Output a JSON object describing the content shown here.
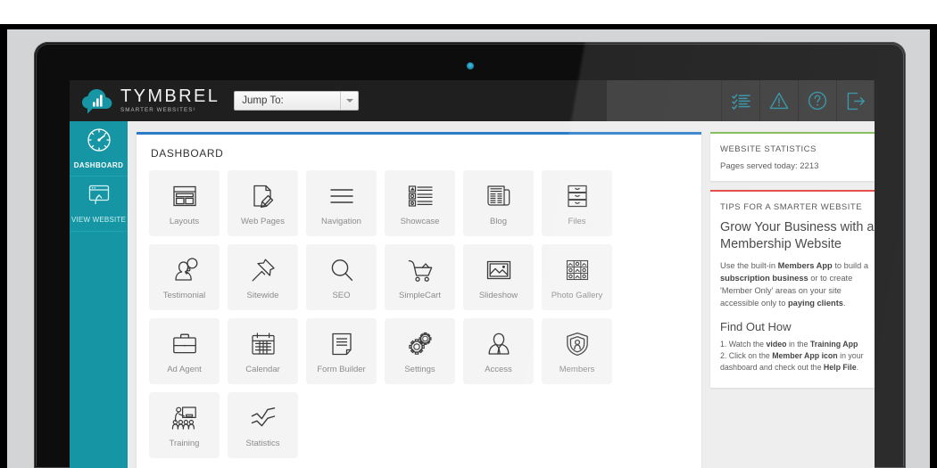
{
  "header": {
    "logo_name": "TYMBREL",
    "logo_tagline": "SMARTER WEBSITES¹",
    "logo_icon": "cloud-bar-chart-icon",
    "jump_to_label": "Jump To:",
    "icons": [
      {
        "name": "checklist-icon"
      },
      {
        "name": "warning-triangle-icon"
      },
      {
        "name": "help-question-icon"
      },
      {
        "name": "logout-icon"
      }
    ]
  },
  "sidebar": {
    "items": [
      {
        "label": "DASHBOARD",
        "icon": "speedometer-icon",
        "active": true
      },
      {
        "label": "VIEW WEBSITE",
        "icon": "browser-arrow-up-icon",
        "active": false
      }
    ]
  },
  "dashboard": {
    "title": "DASHBOARD",
    "accent_color": "#2a7cc7",
    "tiles": [
      {
        "label": "Layouts",
        "icon": "layout-grid-icon"
      },
      {
        "label": "Web Pages",
        "icon": "page-pencil-icon"
      },
      {
        "label": "Navigation",
        "icon": "menu-lines-icon"
      },
      {
        "label": "Showcase",
        "icon": "showcase-list-icon"
      },
      {
        "label": "Blog",
        "icon": "newspaper-icon"
      },
      {
        "label": "Files",
        "icon": "file-drawers-icon"
      },
      {
        "label": "Testimonial",
        "icon": "person-speech-icon"
      },
      {
        "label": "Sitewide",
        "icon": "pushpin-icon"
      },
      {
        "label": "SEO",
        "icon": "magnifier-icon"
      },
      {
        "label": "SimpleCart",
        "icon": "shopping-cart-icon"
      },
      {
        "label": "Slideshow",
        "icon": "image-frame-icon"
      },
      {
        "label": "Photo Gallery",
        "icon": "photo-grid-icon"
      },
      {
        "label": "Ad Agent",
        "icon": "briefcase-icon"
      },
      {
        "label": "Calendar",
        "icon": "calendar-icon"
      },
      {
        "label": "Form Builder",
        "icon": "form-document-icon"
      },
      {
        "label": "Settings",
        "icon": "gears-icon"
      },
      {
        "label": "Access",
        "icon": "user-tie-icon"
      },
      {
        "label": "Members",
        "icon": "shield-user-icon"
      },
      {
        "label": "Training",
        "icon": "classroom-icon"
      },
      {
        "label": "Statistics",
        "icon": "line-chart-icon"
      }
    ]
  },
  "statistics_panel": {
    "accent_color": "#7ab648",
    "heading": "WEBSITE STATISTICS",
    "line": "Pages served today: 2213"
  },
  "tips_panel": {
    "accent_color": "#e23b33",
    "heading": "TIPS FOR A SMARTER WEBSITE",
    "title": "Grow Your Business with a Membership Website",
    "body_1": "Use the built-in ",
    "body_b1": "Members App",
    "body_2": " to build a ",
    "body_b2": "subscription business",
    "body_3": " or to create 'Member Only' areas on your site accessible only to ",
    "body_b3": "paying clients",
    "body_4": ".",
    "subheading": "Find Out How",
    "item1_a": "1. Watch the ",
    "item1_b1": "video",
    "item1_b": " in the ",
    "item1_b2": "Training App",
    "item2_a": "2. Click on the ",
    "item2_b1": "Member App icon",
    "item2_b": " in your dashboard and check out the ",
    "item2_b2": "Help File",
    "item2_c": "."
  }
}
